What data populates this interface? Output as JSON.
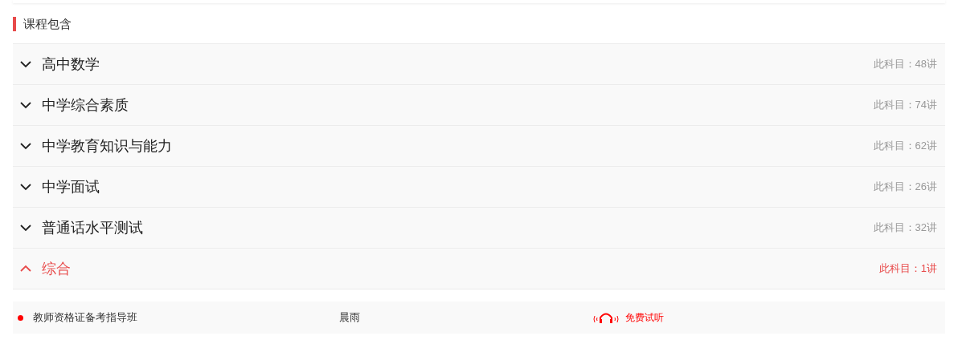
{
  "section_title": "课程包含",
  "subjects": [
    {
      "title": "高中数学",
      "count": "此科目：48讲",
      "expanded": false
    },
    {
      "title": "中学综合素质",
      "count": "此科目：74讲",
      "expanded": false
    },
    {
      "title": "中学教育知识与能力",
      "count": "此科目：62讲",
      "expanded": false
    },
    {
      "title": "中学面试",
      "count": "此科目：26讲",
      "expanded": false
    },
    {
      "title": "普通话水平测试",
      "count": "此科目：32讲",
      "expanded": false
    },
    {
      "title": "综合",
      "count": "此科目：1讲",
      "expanded": true,
      "lessons": [
        {
          "title": "教师资格证备考指导班",
          "teacher": "晨雨",
          "action": "免费试听"
        }
      ]
    }
  ]
}
